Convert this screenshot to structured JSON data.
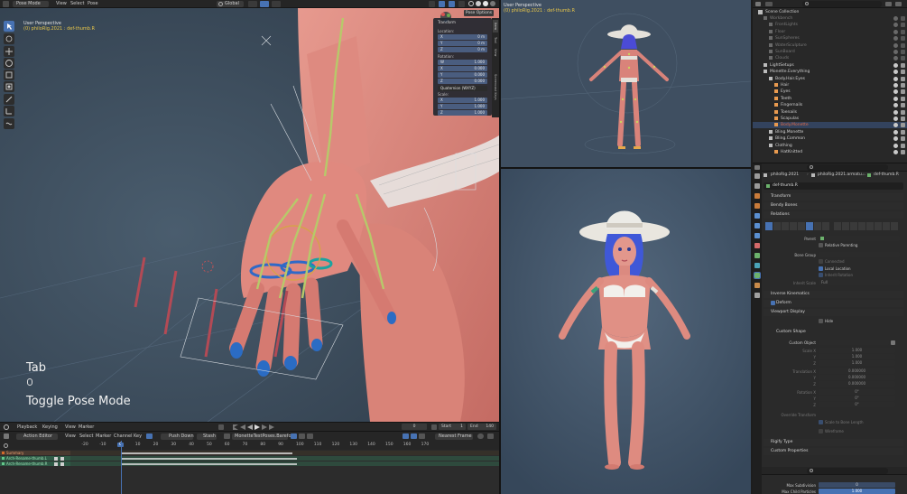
{
  "header": {
    "mode": "Pose Mode",
    "menus": [
      "View",
      "Select",
      "Pose"
    ],
    "orientation": "Global"
  },
  "viewport_left": {
    "title": "User Perspective",
    "subtitle": "(0) philoRig.2021 : def-thumb.R",
    "hud_key": "Tab",
    "hud_action": "Toggle Pose Mode",
    "pose_options": "Pose Options"
  },
  "npanel": {
    "header": "Transform",
    "location_label": "Location:",
    "location": [
      {
        "k": "X",
        "v": "0 m"
      },
      {
        "k": "Y",
        "v": "0 m"
      },
      {
        "k": "Z",
        "v": "0 m"
      }
    ],
    "rotation_label": "Rotation:",
    "rotation": [
      {
        "k": "W",
        "v": "1.000"
      },
      {
        "k": "X",
        "v": "0.000"
      },
      {
        "k": "Y",
        "v": "0.000"
      },
      {
        "k": "Z",
        "v": "0.000"
      }
    ],
    "rotation_mode": "Quaternion (WXYZ)",
    "scale_label": "Scale:",
    "scale": [
      {
        "k": "X",
        "v": "1.000"
      },
      {
        "k": "Y",
        "v": "1.000"
      },
      {
        "k": "Z",
        "v": "1.000"
      }
    ],
    "tabs": [
      "Item",
      "Tool",
      "View",
      "Screencast Keys"
    ]
  },
  "viewport_top_right": {
    "title": "User Perspective",
    "subtitle": "(0) philoRig.2021 : def-thumb.R"
  },
  "timeline": {
    "playback": "Playback",
    "keying": "Keying",
    "view": "View",
    "marker": "Marker",
    "current_frame": "0",
    "start_label": "Start",
    "start": "1",
    "end_label": "End",
    "end": "140"
  },
  "action_editor": {
    "mode": "Action Editor",
    "menus": [
      "View",
      "Select",
      "Marker",
      "Channel",
      "Key"
    ],
    "push_down": "Push Down",
    "stash": "Stash",
    "action_name": "MonetteTestPoses.Barefoot",
    "snap": "Nearest Frame",
    "ruler": [
      "-20",
      "-10",
      "0",
      "10",
      "20",
      "30",
      "40",
      "50",
      "60",
      "70",
      "80",
      "90",
      "100",
      "110",
      "120",
      "130",
      "140",
      "150",
      "160",
      "170"
    ],
    "current_frame": "0",
    "channels": [
      {
        "name": "Summary",
        "color": "#d46a2a"
      },
      {
        "name": "Arch-Rename-thumb.L",
        "color": "#64c88a"
      },
      {
        "name": "Arch-Rename-thumb.R",
        "color": "#64c88a"
      }
    ]
  },
  "outliner": {
    "root": "Scene Collection",
    "items": [
      {
        "label": "Workbench",
        "indent": 1,
        "active": false,
        "dim": true
      },
      {
        "label": "FrontLights",
        "indent": 2,
        "active": false,
        "dim": true
      },
      {
        "label": "Floor",
        "indent": 2,
        "active": false,
        "dim": true
      },
      {
        "label": "SunSpheres",
        "indent": 2,
        "active": false,
        "dim": true
      },
      {
        "label": "WaterSculpture",
        "indent": 2,
        "active": false,
        "dim": true
      },
      {
        "label": "SunBoard",
        "indent": 2,
        "active": false,
        "dim": true
      },
      {
        "label": "Clouds",
        "indent": 2,
        "active": false,
        "dim": true
      },
      {
        "label": "LightSetups",
        "indent": 1,
        "active": false,
        "dim": false
      },
      {
        "label": "Monette.Everything",
        "indent": 1,
        "active": false,
        "dim": false
      },
      {
        "label": "Body.Hair.Eyes",
        "indent": 2,
        "active": false,
        "dim": false
      },
      {
        "label": "Hair",
        "indent": 3,
        "active": false,
        "dim": false
      },
      {
        "label": "Eyes",
        "indent": 3,
        "active": false,
        "dim": false
      },
      {
        "label": "Teeth",
        "indent": 3,
        "active": false,
        "dim": false
      },
      {
        "label": "Fingernails",
        "indent": 3,
        "active": false,
        "dim": false
      },
      {
        "label": "Toenails",
        "indent": 3,
        "active": false,
        "dim": false
      },
      {
        "label": "Scapulas",
        "indent": 3,
        "active": false,
        "dim": false
      },
      {
        "label": "Body.Monette",
        "indent": 3,
        "active": true,
        "dim": false
      },
      {
        "label": "Bling.Monette",
        "indent": 2,
        "active": false,
        "dim": false
      },
      {
        "label": "Bling.Common",
        "indent": 2,
        "active": false,
        "dim": false
      },
      {
        "label": "Clothing",
        "indent": 2,
        "active": false,
        "dim": false
      },
      {
        "label": "HatKnitted",
        "indent": 3,
        "active": false,
        "dim": false
      }
    ]
  },
  "properties": {
    "breadcrumb": [
      "philoRig.2021",
      "philoRig.2021.armatu...",
      "def-thumb.R"
    ],
    "bone_name": "def-thumb.R",
    "sections": {
      "transform": "Transform",
      "bendy": "Bendy Bones",
      "relations": "Relations",
      "ik": "Inverse Kinematics",
      "deform": "Deform",
      "viewport_display": "Viewport Display",
      "custom_shape": "Custom Shape",
      "rigify": "Rigify Type",
      "custom_props": "Custom Properties"
    },
    "relations": {
      "parent": "Parent",
      "relative_parenting": "Relative Parenting",
      "bone_group": "Bone Group",
      "connected": "Connected",
      "local_location": "Local Location",
      "inherit_rotation": "Inherit Rotation",
      "inherit_scale": "Inherit Scale",
      "inherit_scale_value": "Full"
    },
    "viewport_display": {
      "hide": "Hide"
    },
    "custom_shape": {
      "custom_object": "Custom Object",
      "scale_labels": [
        "Scale X",
        "Y",
        "Z"
      ],
      "scale_values": [
        "1.000",
        "1.000",
        "1.000"
      ],
      "translation_labels": [
        "Translation X",
        "Y",
        "Z"
      ],
      "translation_values": [
        "0.000000",
        "0.000000",
        "0.000000"
      ],
      "rotation_labels": [
        "Rotation X",
        "Y",
        "Z"
      ],
      "rotation_values": [
        "0°",
        "0°",
        "0°"
      ],
      "override_transform": "Override Transform",
      "scale_to_bone": "Scale to Bone Length",
      "wireframe": "Wireframe"
    },
    "modifiers": [
      {
        "label": "Max Subdivision",
        "value": "0"
      },
      {
        "label": "Max Child Particles",
        "value": "1.000"
      }
    ]
  },
  "colors": {
    "accent": "#4772b3",
    "skin": "#d9837a",
    "background": "#1d1d1d",
    "viewport_bg": "#3b4b5d",
    "active_item": "#e06b4a",
    "dim_item": "#7a7a7a"
  }
}
